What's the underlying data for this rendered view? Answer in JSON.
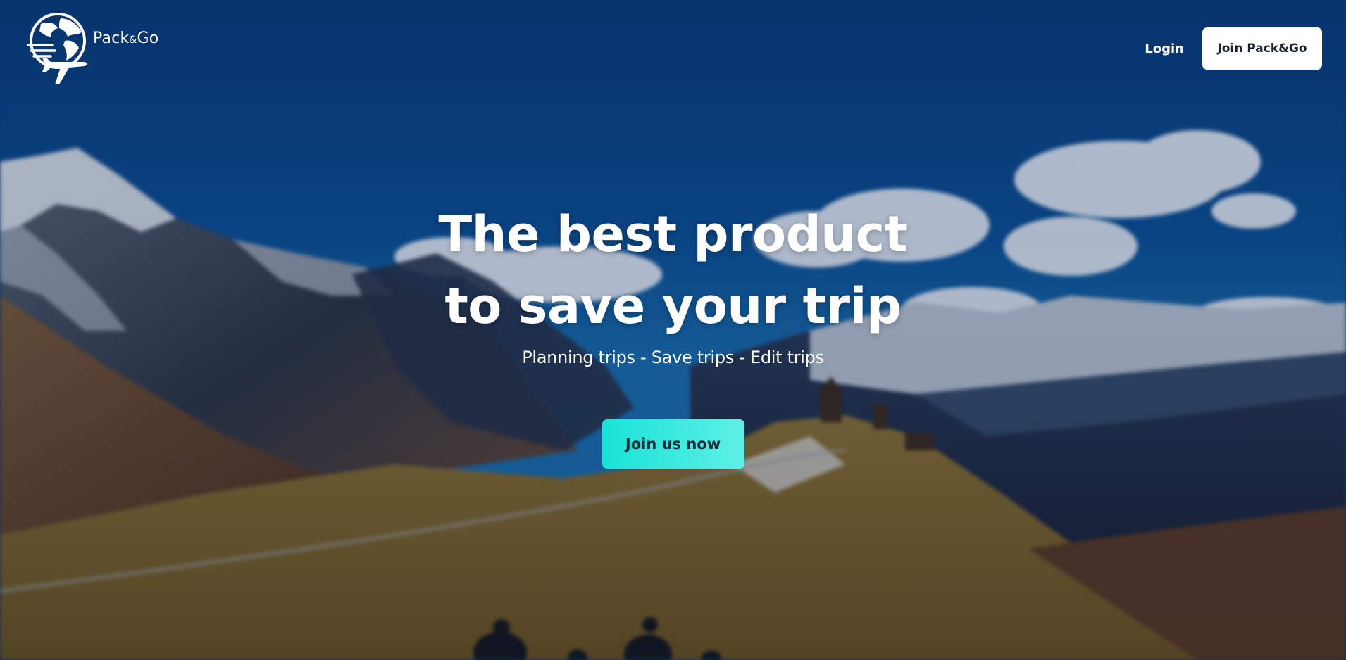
{
  "brand": {
    "name_left": "Pack",
    "name_amp": "&",
    "name_right": "Go",
    "logo_icon": "globe-airplane-icon"
  },
  "nav": {
    "login_label": "Login",
    "join_label": "Join Pack&Go"
  },
  "hero": {
    "title_line1": "The best product",
    "title_line2": "to save your trip",
    "subtitle": "Planning trips - Save trips - Edit trips",
    "cta_label": "Join us now"
  },
  "colors": {
    "sky": "#0b4a8a",
    "cta_start": "#17e3d5",
    "cta_end": "#5ff0e6",
    "button_bg": "#ffffff",
    "text": "#ffffff"
  }
}
